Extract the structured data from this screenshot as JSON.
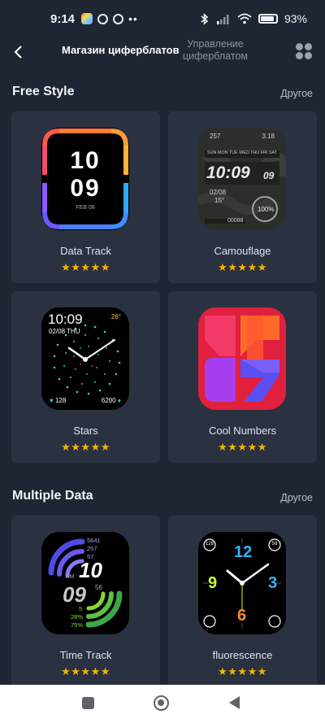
{
  "status_bar": {
    "time": "9:14",
    "battery": "93"
  },
  "header": {
    "back_icon": "chevron-left-icon",
    "tab_active": "Магазин циферблатов",
    "tab_inactive": "Управление циферблатом",
    "grid_icon": "apps-grid-icon"
  },
  "sections": [
    {
      "title": "Free Style",
      "more": "Другое",
      "items": [
        {
          "name": "Data Track",
          "stars": "★★★★★"
        },
        {
          "name": "Camouflage",
          "stars": "★★★★★"
        },
        {
          "name": "Stars",
          "stars": "★★★★★"
        },
        {
          "name": "Cool Numbers",
          "stars": "★★★★★"
        }
      ]
    },
    {
      "title": "Multiple Data",
      "more": "Другое",
      "items": [
        {
          "name": "Time Track",
          "stars": "★★★★★"
        },
        {
          "name": "fluorescence",
          "stars": "★★★★★"
        }
      ]
    }
  ],
  "faces": {
    "data_track": {
      "hour": "10",
      "minute": "09",
      "date": "FEB 08"
    },
    "camouflage": {
      "top_left": "257",
      "top_right": "3.18",
      "days": "SUN MON TUE WED THU FRI SAT",
      "time": "10:09",
      "seconds": "09",
      "date": "02/08",
      "temp": "15°",
      "percent": "100%",
      "steps": "00088"
    },
    "stars": {
      "time": "10:09",
      "date": "02/08 THU",
      "temp": "26°",
      "heart": "128",
      "steps": "6200"
    },
    "time_track": {
      "n1": "5641",
      "n2": "257",
      "n3": "57",
      "am": "AM",
      "hour": "10",
      "minute": "09",
      "sec": "56",
      "p1": "5",
      "p2": "28%",
      "p3": "75%"
    },
    "fluorescence": {
      "twelve": "12",
      "three": "3",
      "six": "6",
      "nine": "9",
      "top_left": "128",
      "top_right": "56"
    }
  },
  "colors": {
    "background": "#1f2633",
    "card": "#2a3140",
    "star": "#f5b400"
  }
}
